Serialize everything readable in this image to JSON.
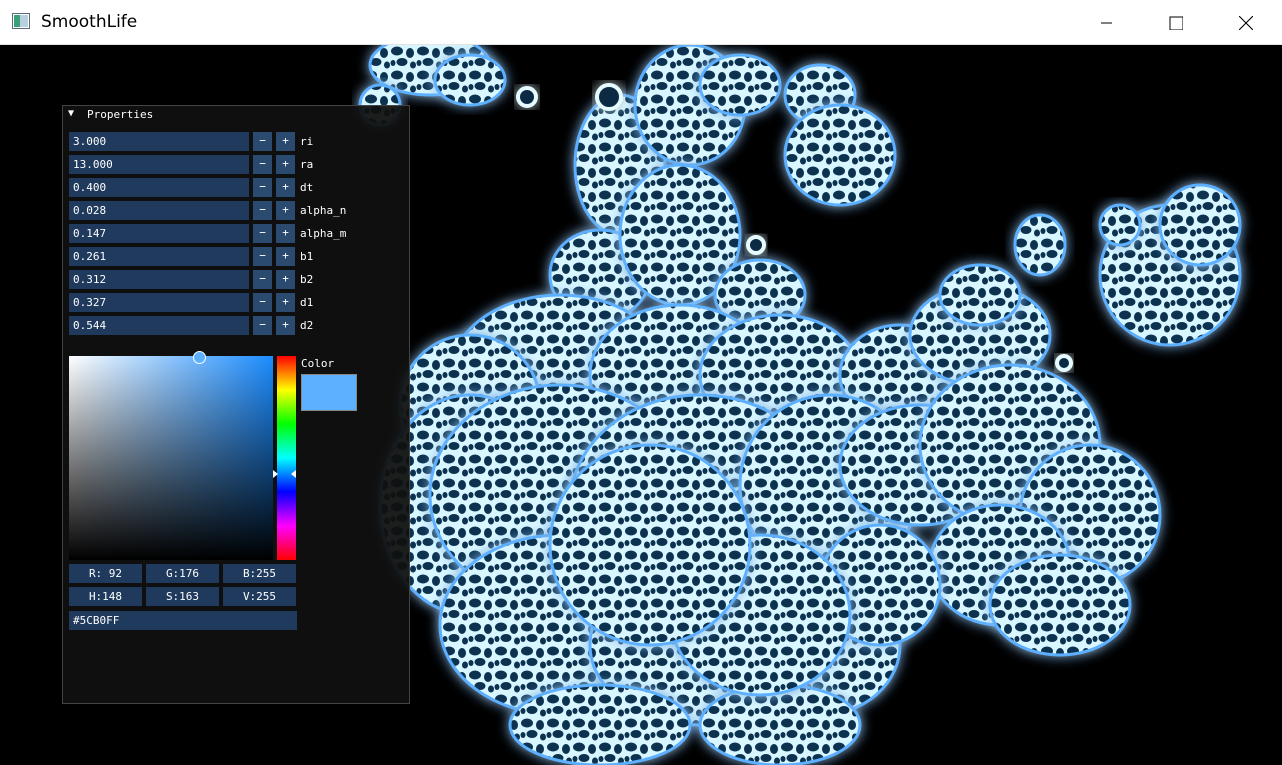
{
  "window": {
    "title": "SmoothLife"
  },
  "panel": {
    "title": "Properties",
    "properties": [
      {
        "value": "3.000",
        "name": "ri"
      },
      {
        "value": "13.000",
        "name": "ra"
      },
      {
        "value": "0.400",
        "name": "dt"
      },
      {
        "value": "0.028",
        "name": "alpha_n"
      },
      {
        "value": "0.147",
        "name": "alpha_m"
      },
      {
        "value": "0.261",
        "name": "b1"
      },
      {
        "value": "0.312",
        "name": "b2"
      },
      {
        "value": "0.327",
        "name": "d1"
      },
      {
        "value": "0.544",
        "name": "d2"
      }
    ],
    "minus_label": "−",
    "plus_label": "+",
    "color": {
      "label": "Color",
      "swatch": "#5CB0FF",
      "r": "R: 92",
      "g": "G:176",
      "b": "B:255",
      "h": "H:148",
      "s": "S:163",
      "v": "V:255",
      "hex": "#5CB0FF"
    }
  },
  "colors": {
    "cell_glow": "#5cb0ff",
    "cell_core": "#e6fbff",
    "hole": "#0a2a44",
    "panel_bg": "#101010",
    "field_bg": "#1f3a5c"
  }
}
